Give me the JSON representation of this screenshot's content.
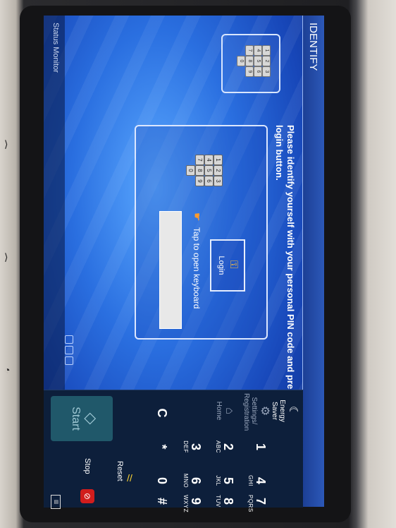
{
  "screen": {
    "title": "IDENTIFY",
    "instruction": "Please identify yourself with your personal PIN code and press the login button.",
    "tap_label": "Tap to open keyboard",
    "login_label": "Login",
    "status_monitor": "Status Monitor"
  },
  "keypad_icon": {
    "keys": [
      "1",
      "2",
      "3",
      "4",
      "5",
      "6",
      "7",
      "8",
      "9",
      "0"
    ]
  },
  "panel": {
    "energy_saver": "Energy Saver",
    "settings_registration": "Settings/ Registration",
    "home": "Home",
    "reset": "Reset",
    "start": "Start",
    "stop": "Stop",
    "keys": [
      {
        "num": "1",
        "letters": ""
      },
      {
        "num": "2",
        "letters": "ABC"
      },
      {
        "num": "3",
        "letters": "DEF"
      },
      {
        "num": "4",
        "letters": "GHI"
      },
      {
        "num": "5",
        "letters": "JKL"
      },
      {
        "num": "6",
        "letters": "MNO"
      },
      {
        "num": "7",
        "letters": "PQRS"
      },
      {
        "num": "8",
        "letters": "TUV"
      },
      {
        "num": "9",
        "letters": "WXYZ"
      },
      {
        "num": "*",
        "letters": ""
      },
      {
        "num": "0",
        "letters": ""
      },
      {
        "num": "#",
        "letters": ""
      },
      {
        "num": "C",
        "letters": ""
      }
    ]
  },
  "icons": {
    "energy": "crescent-moon-icon",
    "settings": "gear-icon",
    "home": "home-icon",
    "start": "diamond-icon",
    "stop": "stop-icon",
    "reset": "reset-icon"
  }
}
